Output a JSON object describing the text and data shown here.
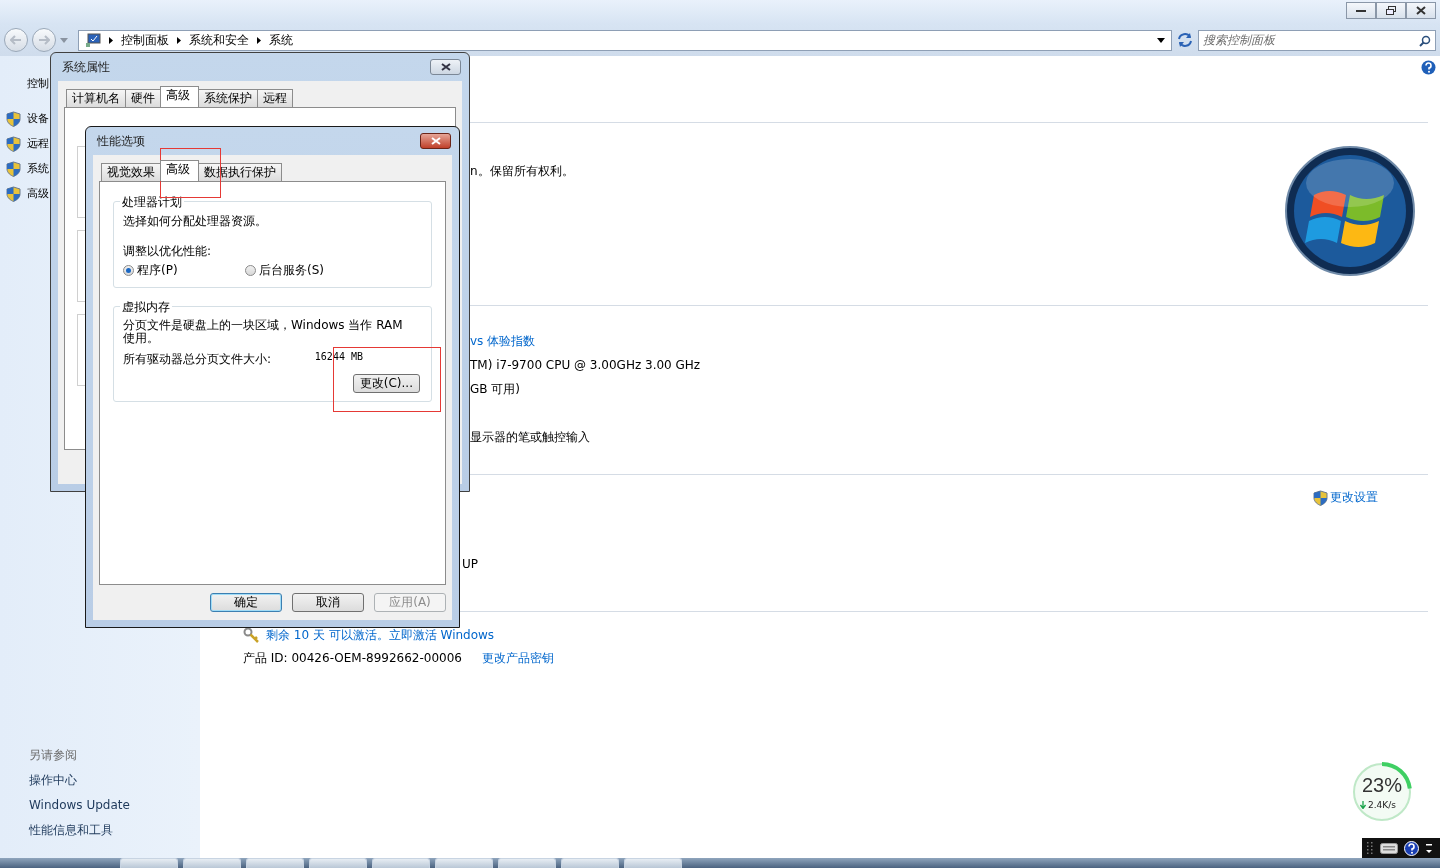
{
  "explorer": {
    "breadcrumb": [
      "控制面板",
      "系统和安全",
      "系统"
    ],
    "search": {
      "placeholder": "搜索控制面板"
    },
    "sidebar": {
      "items": [
        {
          "label": "控制",
          "kind": "link"
        },
        {
          "label": "设备",
          "kind": "shield"
        },
        {
          "label": "远程",
          "kind": "shield"
        },
        {
          "label": "系统",
          "kind": "shield"
        },
        {
          "label": "高级",
          "kind": "shield"
        }
      ],
      "see_also": {
        "title": "另请参阅",
        "links": [
          "操作中心",
          "Windows Update",
          "性能信息和工具"
        ]
      }
    },
    "content": {
      "copyright": "n。保留所有权利。",
      "experience_index": "vs 体验指数",
      "processor": "TM) i7-9700 CPU @ 3.00GHz   3.00 GHz",
      "memory": "GB 可用)",
      "pen": "显示器的笔或触控输入",
      "change_settings": "更改设置",
      "workgroup": "UP",
      "activation": "剩余 10 天 可以激活。立即激活 Windows",
      "product_id": "产品 ID: 00426-OEM-8992662-00006",
      "change_key": "更改产品密钥"
    }
  },
  "system_properties": {
    "title": "系统属性",
    "tabs": [
      {
        "label": "计算机名",
        "selected": false
      },
      {
        "label": "硬件",
        "selected": false
      },
      {
        "label": "高级",
        "selected": true
      },
      {
        "label": "系统保护",
        "selected": false
      },
      {
        "label": "远程",
        "selected": false
      }
    ]
  },
  "performance_options": {
    "title": "性能选项",
    "tabs": [
      {
        "label": "视觉效果",
        "selected": false
      },
      {
        "label": "高级",
        "selected": true
      },
      {
        "label": "数据执行保护",
        "selected": false
      }
    ],
    "processor_group": {
      "title": "处理器计划",
      "description": "选择如何分配处理器资源。",
      "prompt": "调整以优化性能:",
      "options": [
        {
          "label": "程序(P)",
          "selected": true
        },
        {
          "label": "后台服务(S)",
          "selected": false
        }
      ]
    },
    "virtual_memory": {
      "title": "虚拟内存",
      "description": "分页文件是硬盘上的一块区域，Windows 当作 RAM 使用。",
      "total_label": "所有驱动器总分页文件大小:",
      "total_value": "16244 MB",
      "change_button": "更改(C)..."
    },
    "buttons": [
      {
        "label": "确定",
        "kind": "default",
        "disabled": false
      },
      {
        "label": "取消",
        "kind": "normal",
        "disabled": false
      },
      {
        "label": "应用(A)",
        "kind": "normal",
        "disabled": true
      }
    ]
  },
  "network_meter": {
    "percent": "23%",
    "speed": "2.4K/s",
    "level": 0.23
  }
}
